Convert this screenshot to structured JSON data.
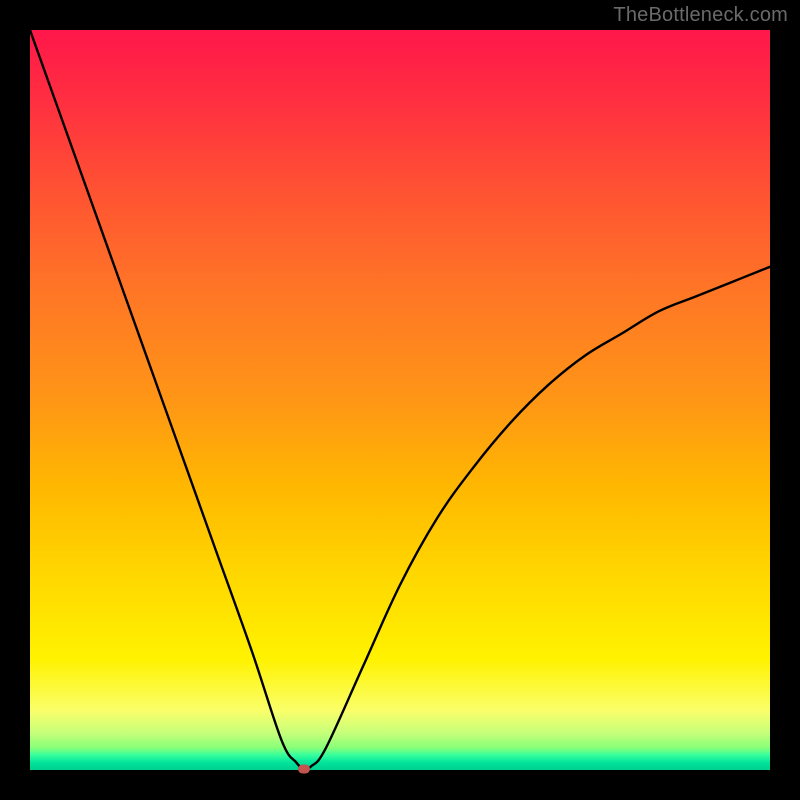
{
  "watermark": "TheBottleneck.com",
  "chart_data": {
    "type": "line",
    "title": "",
    "xlabel": "",
    "ylabel": "",
    "xlim": [
      0,
      100
    ],
    "ylim": [
      0,
      100
    ],
    "grid": false,
    "legend": false,
    "background_gradient": {
      "direction": "vertical",
      "stops": [
        {
          "pos": 0,
          "color": "#ff174a"
        },
        {
          "pos": 50,
          "color": "#ff9616"
        },
        {
          "pos": 85,
          "color": "#fff200"
        },
        {
          "pos": 100,
          "color": "#00d090"
        }
      ]
    },
    "series": [
      {
        "name": "bottleneck-curve",
        "color": "#000000",
        "x": [
          0,
          5,
          10,
          15,
          20,
          25,
          30,
          34,
          36,
          37,
          38,
          40,
          45,
          50,
          55,
          60,
          65,
          70,
          75,
          80,
          85,
          90,
          95,
          100
        ],
        "y": [
          100,
          86,
          72,
          58,
          44,
          30,
          16,
          4,
          1,
          0.2,
          0.5,
          3,
          14,
          25,
          34,
          41,
          47,
          52,
          56,
          59,
          62,
          64,
          66,
          68
        ]
      }
    ],
    "marker": {
      "x": 37,
      "y": 0.2,
      "color": "#c2554f"
    }
  }
}
